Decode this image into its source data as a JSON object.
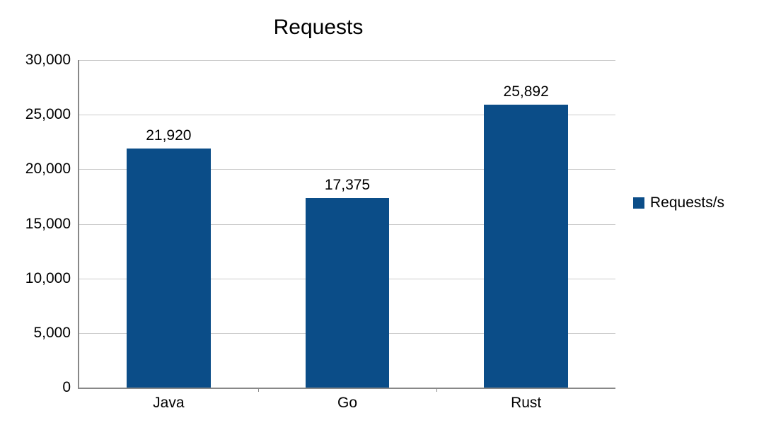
{
  "chart_data": {
    "type": "bar",
    "title": "Requests",
    "categories": [
      "Java",
      "Go",
      "Rust"
    ],
    "series": [
      {
        "name": "Requests/s",
        "values": [
          21920,
          17375,
          25892
        ],
        "color": "#0b4d88"
      }
    ],
    "value_labels": [
      "21,920",
      "17,375",
      "25,892"
    ],
    "y_ticks": [
      0,
      5000,
      10000,
      15000,
      20000,
      25000,
      30000
    ],
    "y_tick_labels": [
      "0",
      "5,000",
      "10,000",
      "15,000",
      "20,000",
      "25,000",
      "30,000"
    ],
    "ylim": [
      0,
      30000
    ],
    "xlabel": "",
    "ylabel": ""
  },
  "legend_label": "Requests/s"
}
